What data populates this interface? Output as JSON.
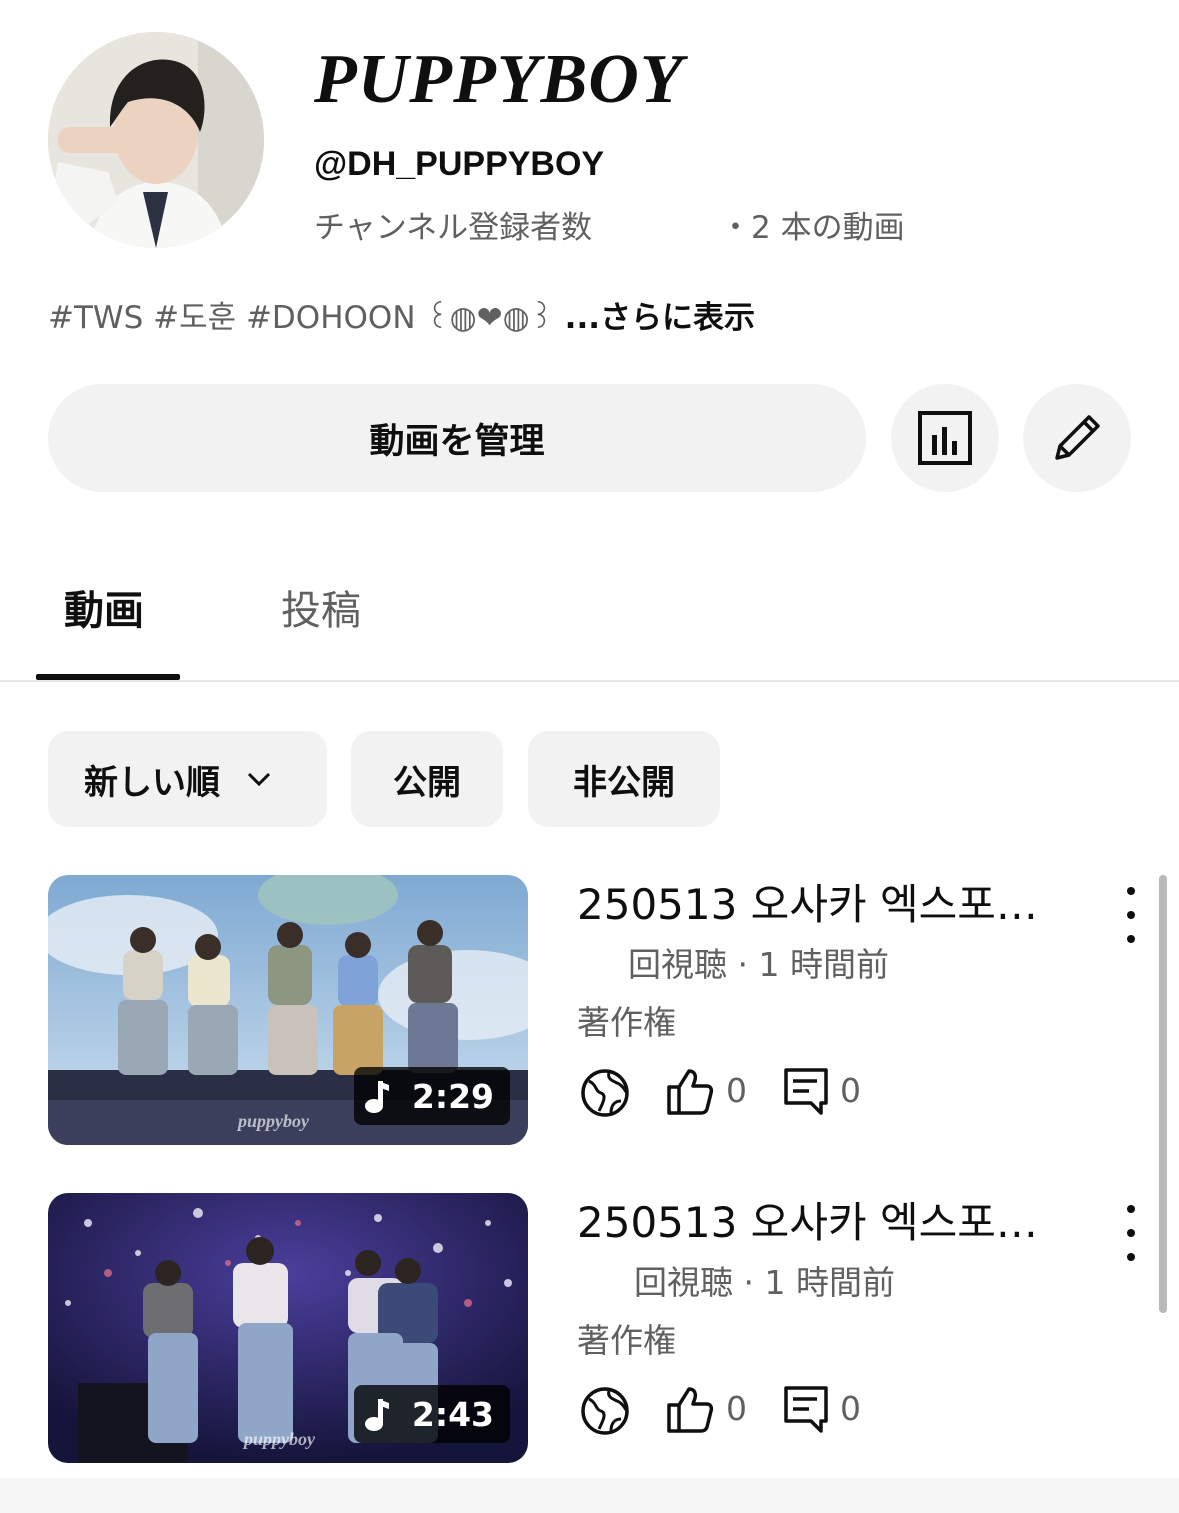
{
  "channel": {
    "name": "PUPPYBOY",
    "handle": "@DH_PUPPYBOY",
    "subscribers_label": "チャンネル登録者数",
    "videos_count": "・2 本の動画",
    "description": "#TWS #도훈 #DOHOON ꒰◍❤︎◍꒱",
    "more_label": " ...さらに表示"
  },
  "actions": {
    "manage_label": "動画を管理",
    "analytics_icon": "analytics-icon",
    "edit_icon": "pencil-icon"
  },
  "tabs": [
    {
      "label": "動画",
      "active": true
    },
    {
      "label": "投稿",
      "active": false
    }
  ],
  "filters": {
    "sort_label": "新しい順",
    "public_label": "公開",
    "private_label": "非公開"
  },
  "videos": [
    {
      "title": "250513 오사카 엑스포…",
      "meta": "回視聴 · 1 時間前",
      "rights": "著作権",
      "duration": "2:29",
      "watermark": "puppyboy",
      "likes": "0",
      "comments": "0"
    },
    {
      "title": "250513 오사카 엑스포…",
      "meta": "回視聴 · 1 時間前",
      "rights": "著作権",
      "duration": "2:43",
      "watermark": "puppyboy",
      "likes": "0",
      "comments": "0"
    }
  ],
  "colors": {
    "text_primary": "#0f0f0f",
    "text_secondary": "#606060",
    "chip_bg": "#f2f2f2"
  }
}
